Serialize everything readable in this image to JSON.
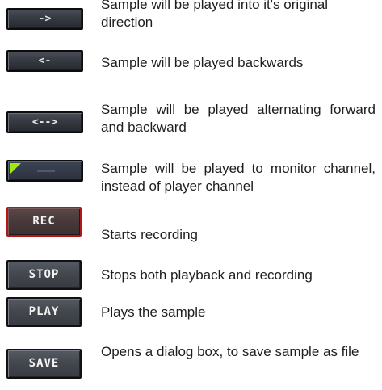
{
  "items": [
    {
      "button_label": "->",
      "description": "Sample will be played into it's original direction"
    },
    {
      "button_label": "<-",
      "description": "Sample will be played backwards"
    },
    {
      "button_label": "<-->",
      "description": "Sample will be played alternating forward and backward"
    },
    {
      "button_label": "",
      "description": "Sample will be played to monitor channel, instead of player channel",
      "flag_color": "#9fe61a"
    },
    {
      "button_label": "REC",
      "description": "Starts recording",
      "border_color": "#b01818"
    },
    {
      "button_label": "STOP",
      "description": "Stops both playback and recording"
    },
    {
      "button_label": "PLAY",
      "description": "Plays the sample"
    },
    {
      "button_label": "SAVE",
      "description": "Opens a dialog box, to save sample as file"
    }
  ]
}
